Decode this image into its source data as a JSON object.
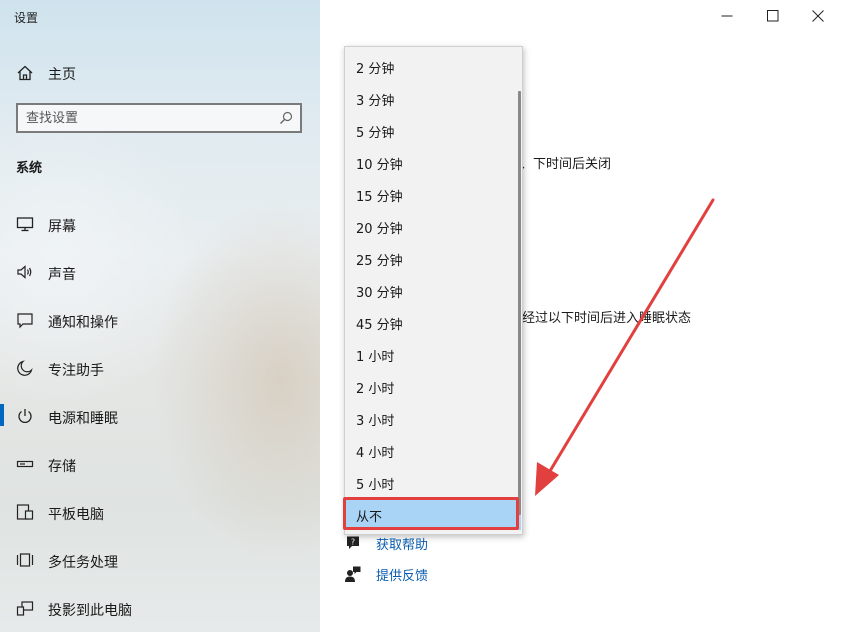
{
  "window": {
    "title": "设置",
    "controls": [
      "minimize",
      "maximize",
      "close"
    ]
  },
  "sidebar": {
    "home_label": "主页",
    "search_placeholder": "查找设置",
    "section_title": "系统",
    "items": [
      {
        "label": "屏幕",
        "icon": "monitor-icon"
      },
      {
        "label": "声音",
        "icon": "speaker-icon"
      },
      {
        "label": "通知和操作",
        "icon": "notification-icon"
      },
      {
        "label": "专注助手",
        "icon": "moon-icon"
      },
      {
        "label": "电源和睡眠",
        "icon": "power-icon",
        "selected": true
      },
      {
        "label": "存储",
        "icon": "storage-icon"
      },
      {
        "label": "平板电脑",
        "icon": "tablet-icon"
      },
      {
        "label": "多任务处理",
        "icon": "multitask-icon"
      },
      {
        "label": "投影到此电脑",
        "icon": "project-icon"
      }
    ]
  },
  "main": {
    "partial_text_1": "、下时间后关闭",
    "partial_text_2": "经过以下时间后进入睡眠状态",
    "links": [
      {
        "label": "获取帮助",
        "icon": "help-icon"
      },
      {
        "label": "提供反馈",
        "icon": "feedback-icon"
      }
    ]
  },
  "dropdown": {
    "options": [
      "2 分钟",
      "3 分钟",
      "5 分钟",
      "10 分钟",
      "15 分钟",
      "20 分钟",
      "25 分钟",
      "30 分钟",
      "45 分钟",
      "1 小时",
      "2 小时",
      "3 小时",
      "4 小时",
      "5 小时",
      "从不"
    ],
    "selected": "从不"
  },
  "annotation": {
    "color": "#e2403e"
  },
  "colors": {
    "accent": "#0067c0",
    "selected_option_bg": "#a9d4f5",
    "link": "#0a5db0"
  }
}
